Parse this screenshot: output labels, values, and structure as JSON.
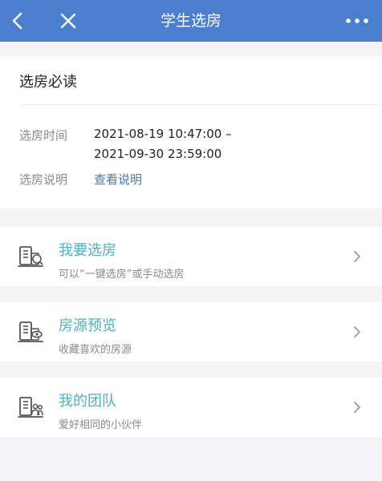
{
  "header": {
    "title": "学生选房",
    "back_icon": "chevron-left-icon",
    "close_icon": "close-icon",
    "more_icon": "more-horizontal-icon",
    "bg_color": "#4a7fcf"
  },
  "notice": {
    "title": "选房必读",
    "time_label": "选房时间",
    "time_start": "2021-08-19 10:47:00 –",
    "time_end": "2021-09-30 23:59:00",
    "desc_label": "选房说明",
    "desc_link": "查看说明",
    "link_color": "#3b79c8"
  },
  "menu": [
    {
      "title": "我要选房",
      "subtitle": "可以“一键选房”或手动选房",
      "icon": "building-select-icon"
    },
    {
      "title": "房源预览",
      "subtitle": "收藏喜欢的房源",
      "icon": "building-preview-icon"
    },
    {
      "title": "我的团队",
      "subtitle": "爱好相同的小伙伴",
      "icon": "building-team-icon"
    }
  ],
  "accent_color": "#4fb0bf"
}
